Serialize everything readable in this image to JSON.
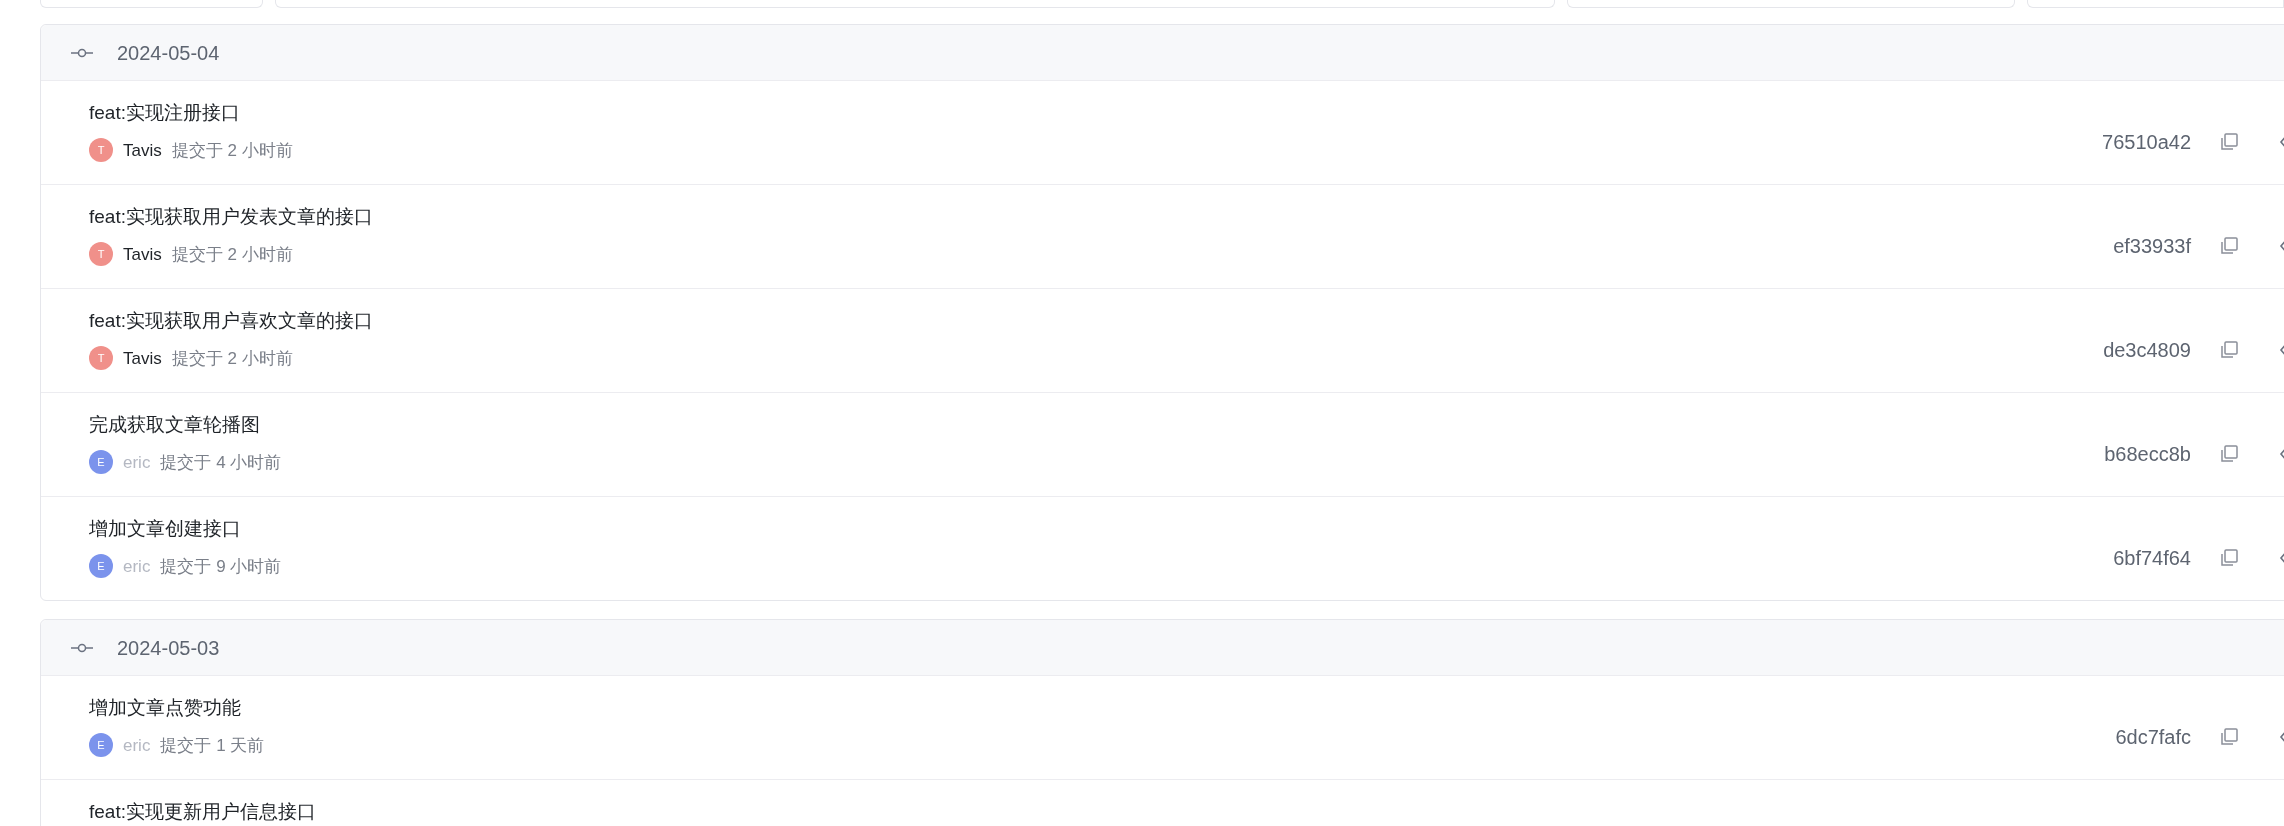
{
  "groups": [
    {
      "date": "2024-05-04",
      "commits": [
        {
          "title": "feat:实现注册接口",
          "initial": "T",
          "color": "#f0908a",
          "author": "Tavis",
          "author_muted": false,
          "time": "提交于 2 小时前",
          "hash": "76510a42"
        },
        {
          "title": "feat:实现获取用户发表文章的接口",
          "initial": "T",
          "color": "#f0908a",
          "author": "Tavis",
          "author_muted": false,
          "time": "提交于 2 小时前",
          "hash": "ef33933f"
        },
        {
          "title": "feat:实现获取用户喜欢文章的接口",
          "initial": "T",
          "color": "#f0908a",
          "author": "Tavis",
          "author_muted": false,
          "time": "提交于 2 小时前",
          "hash": "de3c4809"
        },
        {
          "title": "完成获取文章轮播图",
          "initial": "E",
          "color": "#7b93ec",
          "author": "eric",
          "author_muted": true,
          "time": "提交于 4 小时前",
          "hash": "b68ecc8b"
        },
        {
          "title": "增加文章创建接口",
          "initial": "E",
          "color": "#7b93ec",
          "author": "eric",
          "author_muted": true,
          "time": "提交于 9 小时前",
          "hash": "6bf74f64"
        }
      ]
    },
    {
      "date": "2024-05-03",
      "commits": [
        {
          "title": "增加文章点赞功能",
          "initial": "E",
          "color": "#7b93ec",
          "author": "eric",
          "author_muted": true,
          "time": "提交于 1 天前",
          "hash": "6dc7fafc"
        },
        {
          "title": "feat:实现更新用户信息接口"
        }
      ]
    }
  ]
}
